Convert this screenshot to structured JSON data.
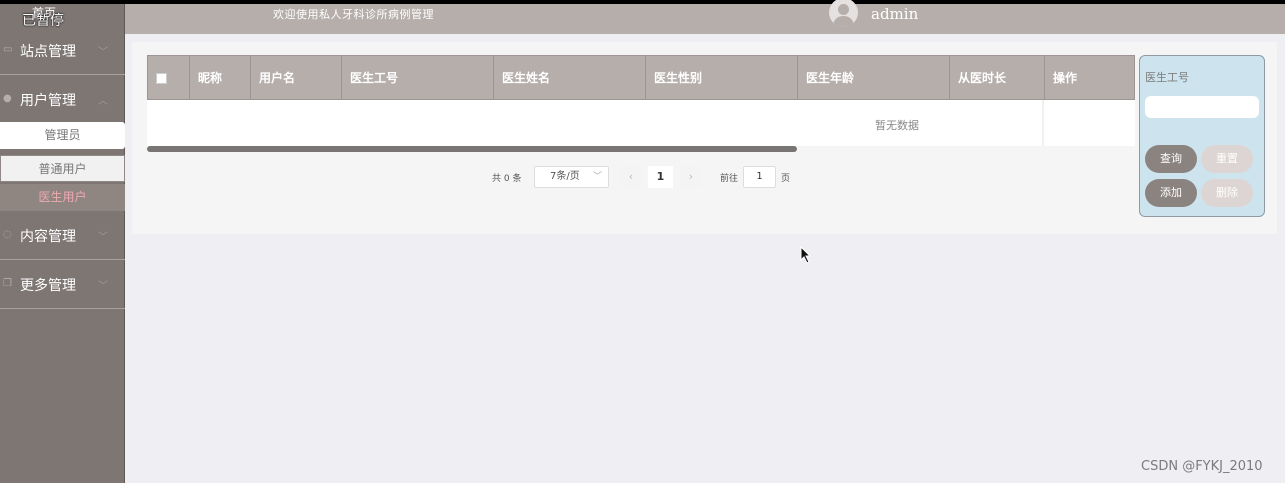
{
  "sidebar": {
    "home_label": "首页",
    "paused_label": "已暂停",
    "groups": [
      {
        "label": "站点管理",
        "icon": "monitor-icon"
      },
      {
        "label": "用户管理",
        "icon": "user-icon"
      },
      {
        "label": "内容管理",
        "icon": "chat-icon"
      },
      {
        "label": "更多管理",
        "icon": "copy-icon"
      }
    ],
    "user_subitems": [
      "管理员",
      "普通用户",
      "医生用户"
    ]
  },
  "header": {
    "welcome": "欢迎使用私人牙科诊所病例管理",
    "username": "admin"
  },
  "table": {
    "columns": [
      "昵称",
      "用户名",
      "医生工号",
      "医生姓名",
      "医生性别",
      "医生年龄",
      "从医时长",
      "操作"
    ],
    "empty_text": "暂无数据"
  },
  "pagination": {
    "total": "共 0 条",
    "page_size": "7条/页",
    "current_page": "1",
    "goto_label": "前往",
    "goto_value": "1",
    "page_suffix": "页"
  },
  "search": {
    "field_label": "医生工号",
    "input_value": "",
    "buttons": {
      "query": "查询",
      "reset": "重置",
      "add": "添加",
      "delete": "删除"
    }
  },
  "watermark": "CSDN @FYKJ_2010",
  "colors": {
    "sidebar": "#7e7673",
    "header": "#b5aeab",
    "active_item_text": "#f0a9b2",
    "search_panel": "#cde4ee"
  }
}
